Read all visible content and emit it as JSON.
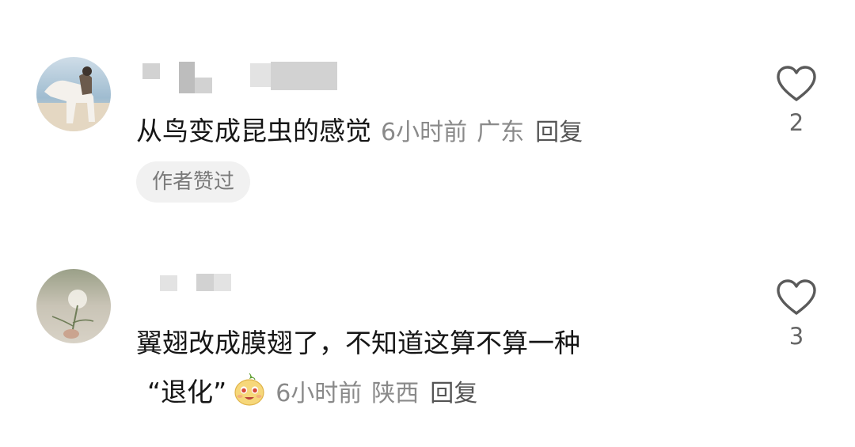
{
  "comments": [
    {
      "text": "从鸟变成昆虫的感觉",
      "time": "6小时前",
      "location": "广东",
      "reply_label": "回复",
      "author_liked_label": "作者赞过",
      "like_count": "2"
    },
    {
      "text_line1": "翼翅改成膜翅了，不知道这算不算一种",
      "text_line2": "“退化”",
      "emoji_icon": "smiling-emoji-icon",
      "time": "6小时前",
      "location": "陕西",
      "reply_label": "回复",
      "like_count": "3"
    }
  ],
  "icons": {
    "like": "heart-outline-icon"
  },
  "colors": {
    "meta_text": "#8a8a8a",
    "badge_bg": "#f1f1f1"
  }
}
